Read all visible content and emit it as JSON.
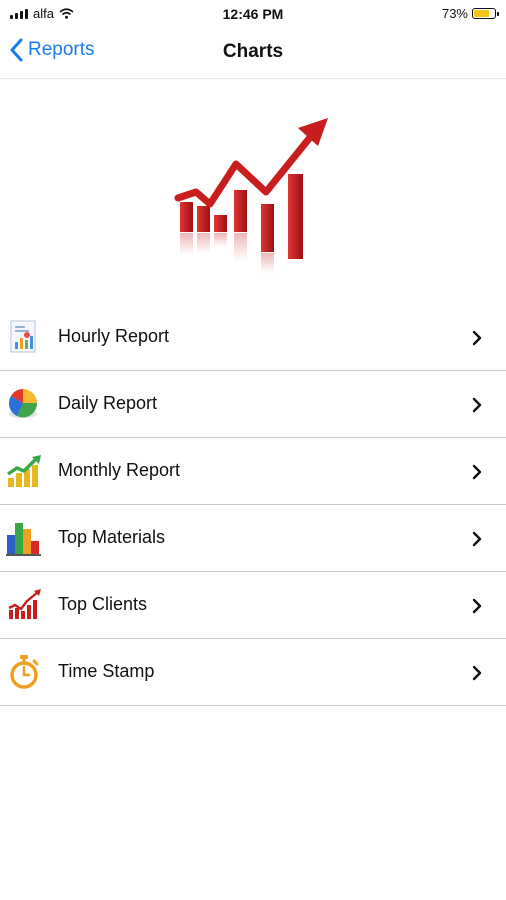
{
  "status_bar": {
    "carrier": "alfa",
    "time": "12:46 PM",
    "battery": "73%",
    "battery_level": 0.73
  },
  "nav": {
    "back_label": "Reports",
    "title": "Charts"
  },
  "hero_icon": "growth-chart-icon",
  "menu": [
    {
      "label": "Hourly Report",
      "icon": "hourly-report-icon"
    },
    {
      "label": "Daily Report",
      "icon": "pie-chart-icon"
    },
    {
      "label": "Monthly Report",
      "icon": "growth-bars-icon"
    },
    {
      "label": " Top Materials",
      "icon": "bar-chart-icon"
    },
    {
      "label": "Top Clients",
      "icon": "trend-chart-icon"
    },
    {
      "label": "Time Stamp",
      "icon": "stopwatch-icon"
    }
  ],
  "colors": {
    "accent": "#1a7cf2",
    "battery": "#f5c518",
    "divider": "#c8c8c8",
    "chart_red": "#c81e1e"
  }
}
